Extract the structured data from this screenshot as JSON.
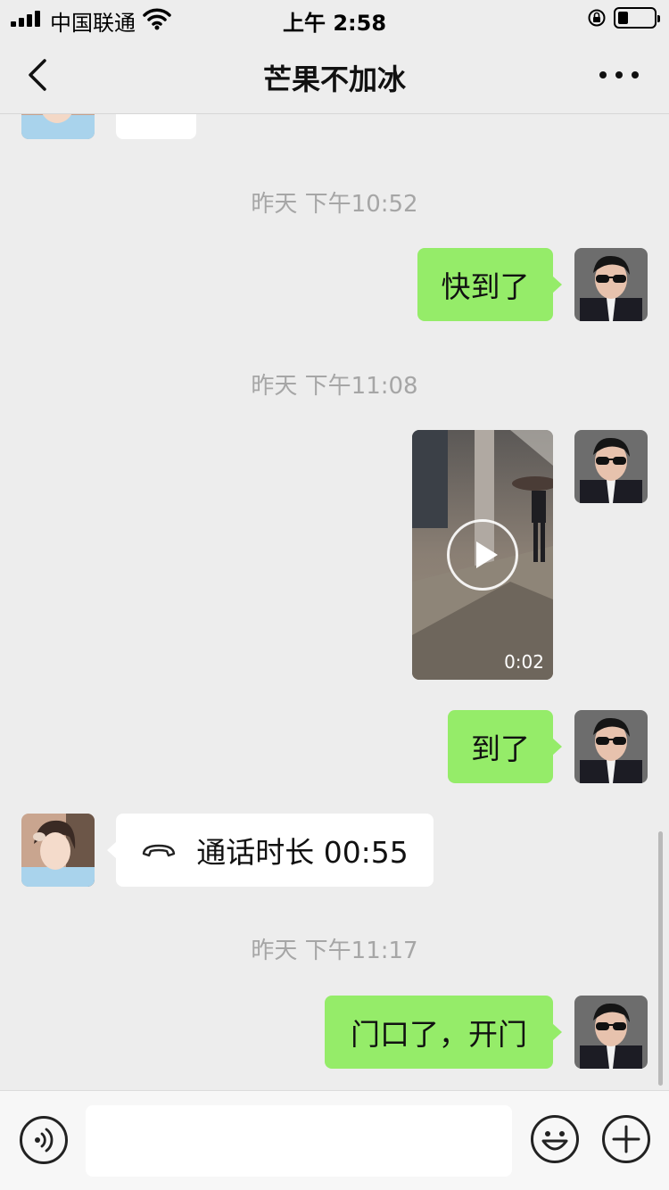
{
  "status_bar": {
    "carrier": "中国联通",
    "time": "上午 2:58",
    "battery_level": 0.3
  },
  "nav": {
    "title": "芒果不加冰"
  },
  "messages": [
    {
      "kind": "timestamp",
      "text": "昨天 下午10:52"
    },
    {
      "kind": "text",
      "sender": "me",
      "text": "快到了"
    },
    {
      "kind": "timestamp",
      "text": "昨天 下午11:08"
    },
    {
      "kind": "video",
      "sender": "me",
      "duration": "0:02"
    },
    {
      "kind": "text",
      "sender": "me",
      "text": "到了"
    },
    {
      "kind": "call",
      "sender": "contact",
      "icon": "phone-hangup-icon",
      "text": "通话时长 00:55"
    },
    {
      "kind": "timestamp",
      "text": "昨天 下午11:17"
    },
    {
      "kind": "text",
      "sender": "me",
      "text": "门口了，开门"
    }
  ],
  "input_bar": {
    "value": "",
    "placeholder": ""
  },
  "colors": {
    "background": "#ededed",
    "sent_bubble": "#95ec69",
    "received_bubble": "#ffffff",
    "timestamp": "#a6a6a6"
  }
}
